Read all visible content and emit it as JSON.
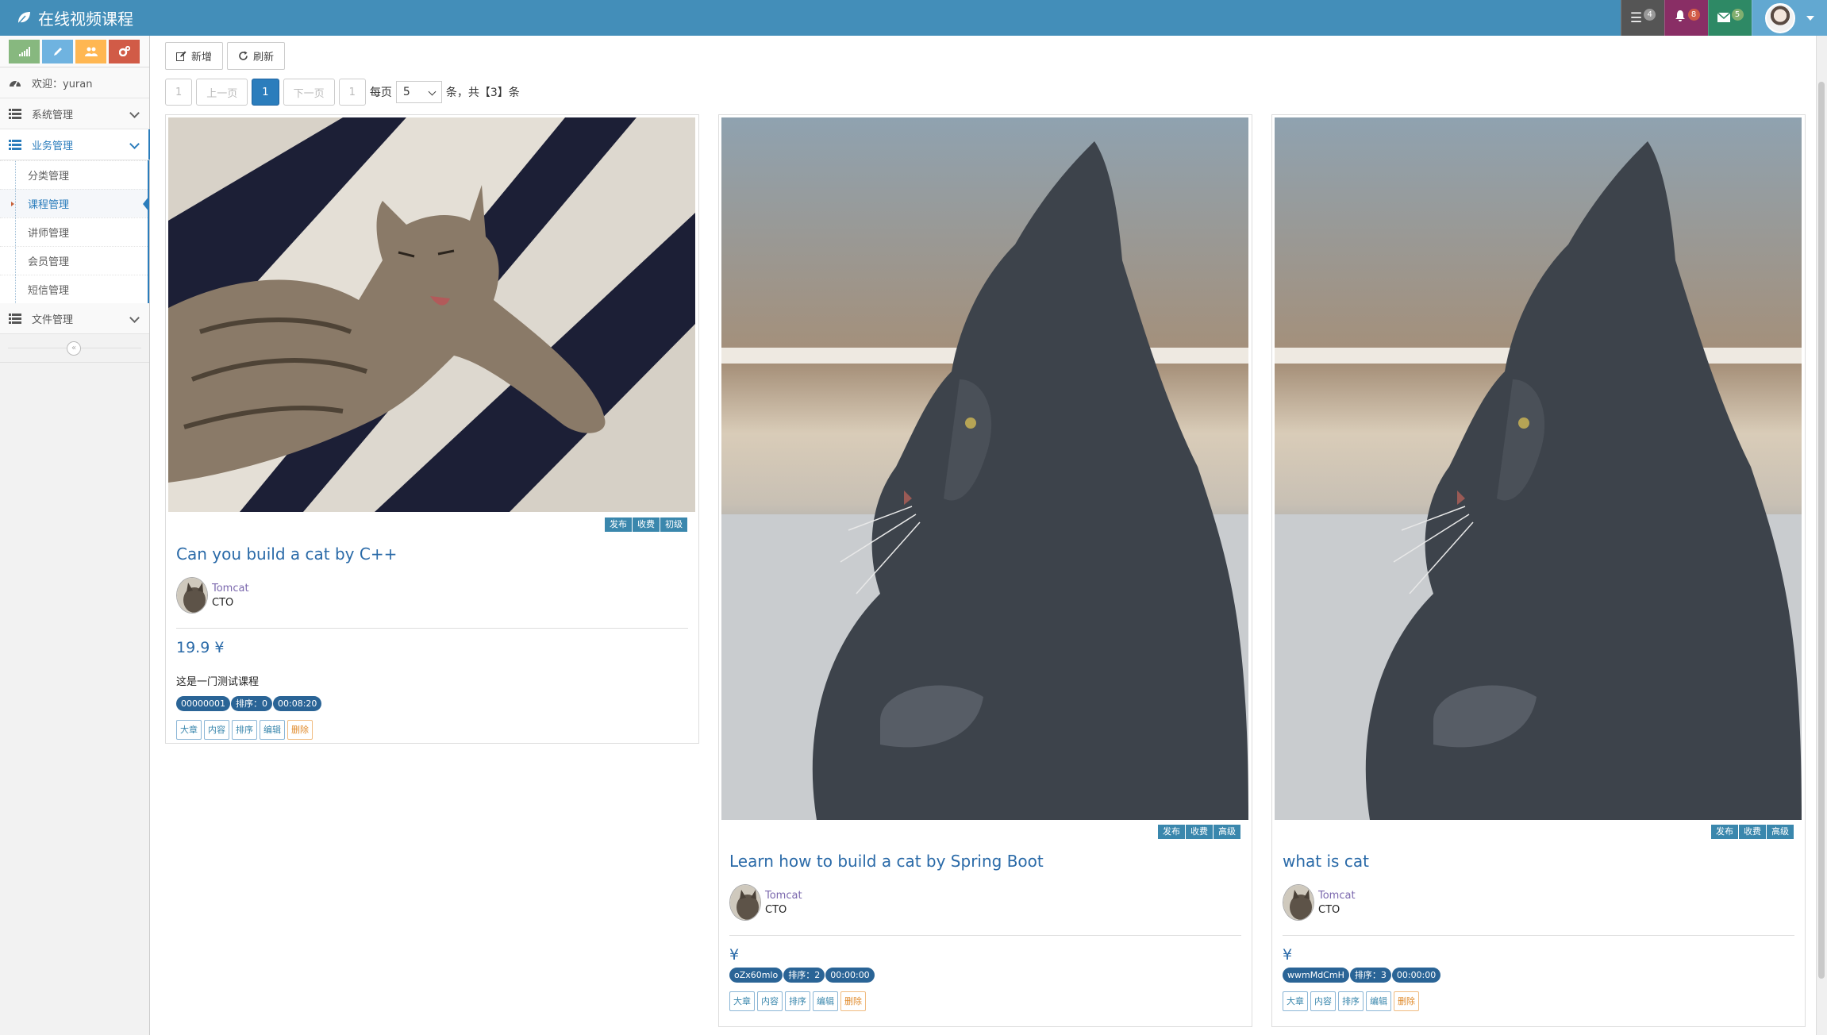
{
  "app": {
    "title": "在线视频课程"
  },
  "navbar": {
    "tasks_count": "4",
    "notifications_count": "8",
    "messages_count": "5"
  },
  "sidebar": {
    "welcome": "欢迎：yuran",
    "menus": [
      {
        "label": "系统管理"
      },
      {
        "label": "业务管理",
        "children": [
          "分类管理",
          "课程管理",
          "讲师管理",
          "会员管理",
          "短信管理"
        ]
      },
      {
        "label": "文件管理"
      }
    ],
    "collapse_icon": "«"
  },
  "toolbar": {
    "add_label": "新增",
    "refresh_label": "刷新"
  },
  "pager": {
    "first": "1",
    "prev": "上一页",
    "current": "1",
    "next": "下一页",
    "last": "1",
    "per_page_prefix": "每页",
    "page_size": "5",
    "suffix": "条，共【3】条"
  },
  "courses": [
    {
      "title": "Can you build a cat by C++",
      "labels": [
        "发布",
        "收费",
        "初级"
      ],
      "teacher_name": "Tomcat",
      "teacher_position": "CTO",
      "price": "19.9 ¥",
      "summary": "这是一门测试课程",
      "id": "00000001",
      "sort": "排序：0",
      "time": "00:08:20",
      "actions": [
        "大章",
        "内容",
        "排序",
        "编辑",
        "删除"
      ]
    },
    {
      "title": "Learn how to build a cat by Spring Boot",
      "labels": [
        "发布",
        "收费",
        "高级"
      ],
      "teacher_name": "Tomcat",
      "teacher_position": "CTO",
      "price": "¥",
      "summary": "",
      "id": "oZx60mlo",
      "sort": "排序：2",
      "time": "00:00:00",
      "actions": [
        "大章",
        "内容",
        "排序",
        "编辑",
        "删除"
      ]
    },
    {
      "title": "what is cat",
      "labels": [
        "发布",
        "收费",
        "高级"
      ],
      "teacher_name": "Tomcat",
      "teacher_position": "CTO",
      "price": "¥",
      "summary": "",
      "id": "wwmMdCmH",
      "sort": "排序：3",
      "time": "00:00:00",
      "actions": [
        "大章",
        "内容",
        "排序",
        "编辑",
        "删除"
      ]
    }
  ],
  "colors": {
    "navbar": "#438eb9",
    "accent": "#2b7dbc",
    "label": "#3a87ad",
    "danger": "#e08a2b"
  }
}
